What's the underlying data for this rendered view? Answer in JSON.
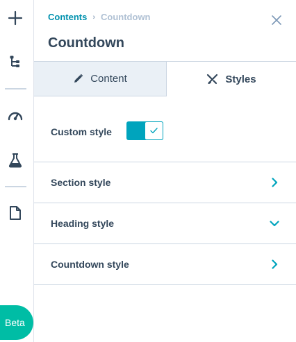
{
  "rail": {
    "beta_label": "Beta",
    "icons": [
      "plus-icon",
      "tree-icon",
      "gauge-icon",
      "flask-icon",
      "document-icon"
    ]
  },
  "header": {
    "breadcrumb_parent": "Contents",
    "breadcrumb_current": "Countdown",
    "title": "Countdown"
  },
  "tabs": [
    {
      "label": "Content",
      "icon": "pencil-icon",
      "active": false
    },
    {
      "label": "Styles",
      "icon": "brush-icon",
      "active": true
    }
  ],
  "panel": {
    "custom_style_label": "Custom style",
    "custom_style_enabled": true,
    "sections": [
      {
        "label": "Section style",
        "expanded": false
      },
      {
        "label": "Heading style",
        "expanded": true
      },
      {
        "label": "Countdown style",
        "expanded": false
      }
    ]
  },
  "colors": {
    "accent": "#00a4bd",
    "beta": "#00bda5",
    "link": "#0091ae",
    "text": "#33475b",
    "tab_inactive_bg": "#eaf0f6",
    "border": "#cbd6e2"
  }
}
